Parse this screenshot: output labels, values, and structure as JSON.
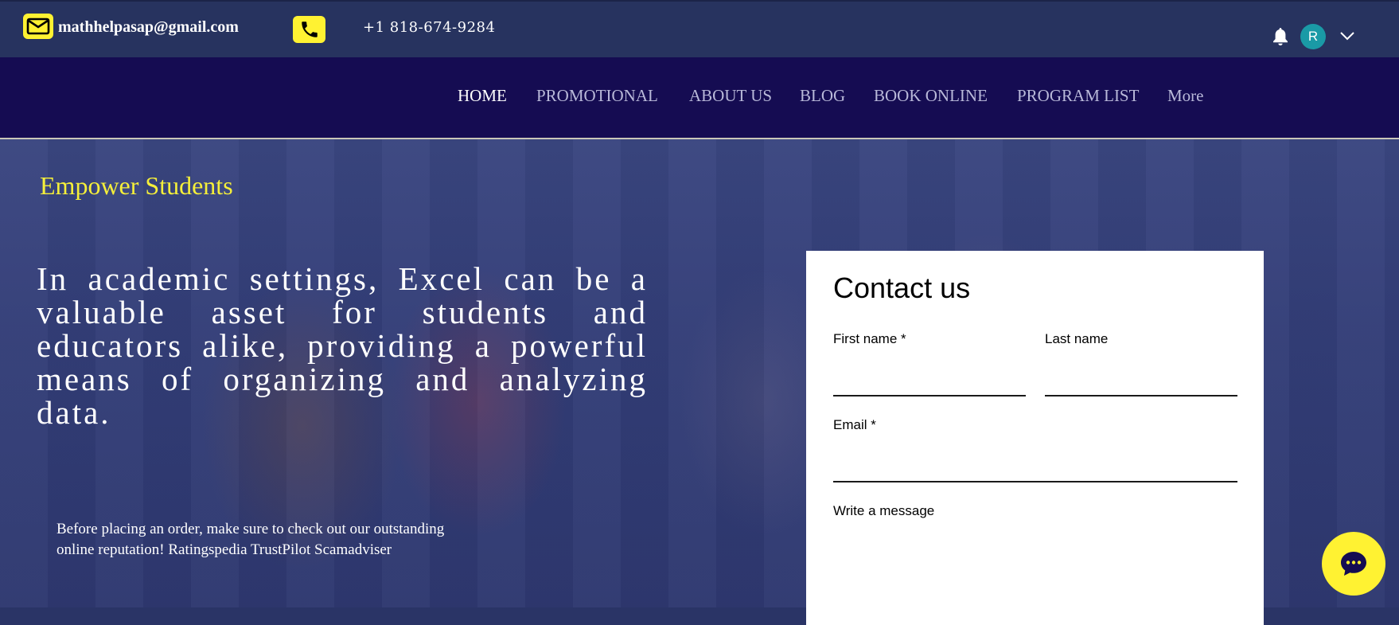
{
  "topbar": {
    "email": "mathhelpasap@gmail.com",
    "phone": "+1 818-674-9284",
    "avatar_initial": "R",
    "icons": {
      "email": "mail-icon",
      "phone": "phone-icon",
      "notifications": "bell-icon",
      "menu": "chevron-down-icon"
    },
    "accent_color": "#fff232"
  },
  "nav": {
    "items": [
      {
        "label": "HOME",
        "active": true
      },
      {
        "label": "PROMOTIONAL"
      },
      {
        "label": "ABOUT US"
      },
      {
        "label": "BLOG"
      },
      {
        "label": "BOOK ONLINE"
      },
      {
        "label": "PROGRAM LIST"
      },
      {
        "label": "More"
      }
    ]
  },
  "hero": {
    "eyebrow": "Empower Students",
    "headline": "In academic settings, Excel can be a valuable asset for students and educators alike, providing a powerful means of organizing and analyzing data.",
    "note": "Before placing an order, make sure to check out our outstanding online reputation! Ratingspedia TrustPilot Scamadviser"
  },
  "contact": {
    "title": "Contact us",
    "first_name_label": "First name *",
    "last_name_label": "Last name",
    "email_label": "Email *",
    "message_label": "Write a message"
  },
  "chat": {
    "icon": "chat-bubble-icon"
  }
}
